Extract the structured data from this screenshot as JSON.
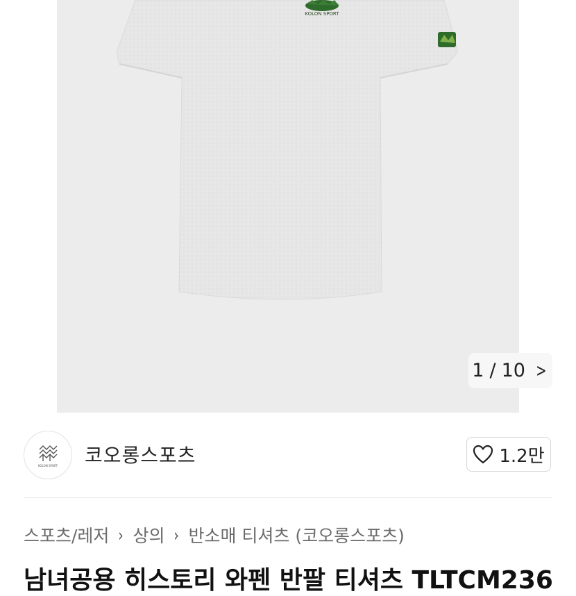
{
  "gallery": {
    "current": "1",
    "separator": "/",
    "total": "10",
    "next_icon": "chevron-right-icon",
    "image_brand_text": "KOLON SPORT"
  },
  "seller": {
    "name": "코오롱스포츠",
    "avatar_icon": "brand-logo-icon",
    "avatar_caption": "KOLON SPORT",
    "like_icon": "heart-outline-icon",
    "like_count": "1.2만"
  },
  "breadcrumb": {
    "items": [
      "스포츠/레저",
      "상의",
      "반소매 티셔츠 (코오롱스포츠)"
    ],
    "arrow": "›"
  },
  "product": {
    "title": "남녀공용 히스토리 와펜 반팔 티셔츠 TLTCM236"
  },
  "colors": {
    "shirt": "#e6e6e6",
    "gallery_bg": "#ececec",
    "logo_green": "#2f6b2b"
  }
}
